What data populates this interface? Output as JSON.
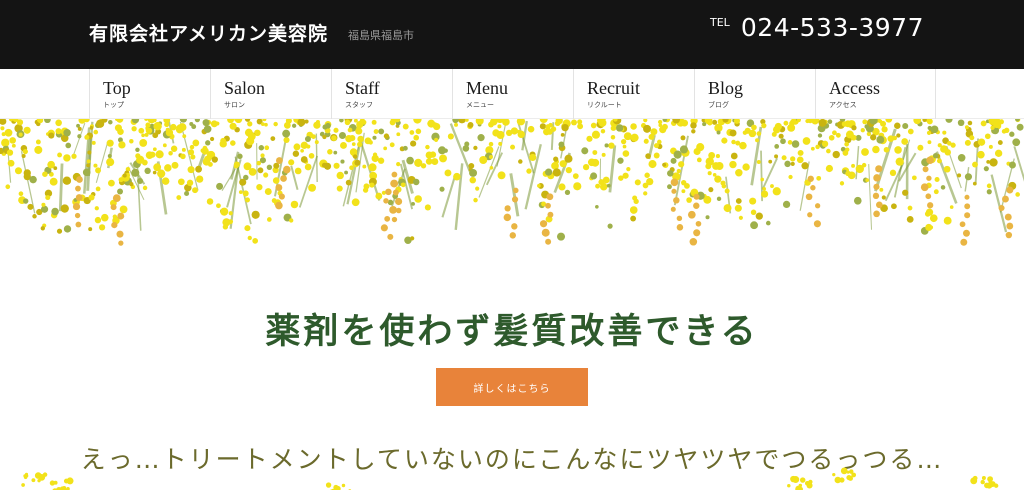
{
  "header": {
    "brand": "有限会社アメリカン美容院",
    "location": "福島県福島市",
    "tel_label": "TEL",
    "tel_number": "024-533-3977"
  },
  "nav": {
    "items": [
      {
        "en": "Top",
        "ja": "トップ"
      },
      {
        "en": "Salon",
        "ja": "サロン"
      },
      {
        "en": "Staff",
        "ja": "スタッフ"
      },
      {
        "en": "Menu",
        "ja": "メニュー"
      },
      {
        "en": "Recruit",
        "ja": "リクルート"
      },
      {
        "en": "Blog",
        "ja": "ブログ"
      },
      {
        "en": "Access",
        "ja": "アクセス"
      }
    ]
  },
  "main": {
    "headline": "薬剤を使わず髪質改善できる",
    "cta_label": "詳しくはこちら",
    "tagline": "えっ…トリートメントしていないのにこんなにツヤツヤでつるっつる…"
  },
  "colors": {
    "header_bg": "#141414",
    "headline": "#2e5a2c",
    "cta_bg": "#e8833a",
    "tagline": "#6b6a2c",
    "mimosa_yellow": "#f2e21a",
    "mimosa_leaf": "#7f9a3a"
  }
}
